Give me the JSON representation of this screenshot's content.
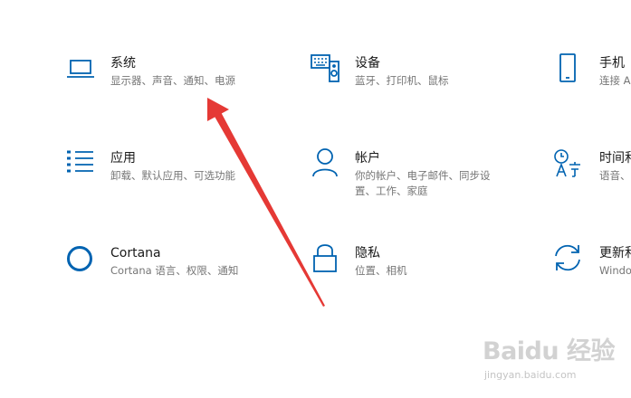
{
  "settings": {
    "tiles": [
      {
        "title": "系统",
        "desc": "显示器、声音、通知、电源"
      },
      {
        "title": "设备",
        "desc": "蓝牙、打印机、鼠标"
      },
      {
        "title": "手机",
        "desc": "连接 A"
      },
      {
        "title": "应用",
        "desc": "卸载、默认应用、可选功能"
      },
      {
        "title": "帐户",
        "desc": "你的帐户、电子邮件、同步设",
        "desc2": "置、工作、家庭"
      },
      {
        "title": "时间和",
        "desc": "语音、"
      },
      {
        "title": "Cortana",
        "desc": "Cortana 语言、权限、通知"
      },
      {
        "title": "隐私",
        "desc": "位置、相机"
      },
      {
        "title": "更新和",
        "desc": "Windo"
      }
    ]
  },
  "watermark": {
    "main": "Baidu 经验",
    "sub": "jingyan.baidu.com"
  },
  "colors": {
    "accent": "#0063b1",
    "arrow": "#e53935",
    "title": "#1a1a1a",
    "desc": "#767676"
  }
}
